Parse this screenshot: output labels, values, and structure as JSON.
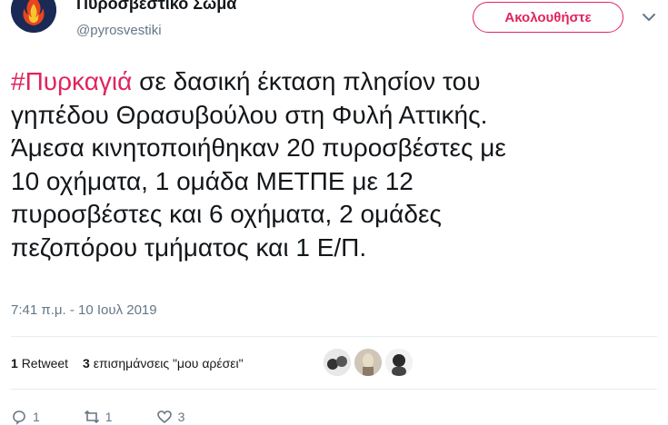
{
  "author": {
    "name": "Πυροσβεστικό Σώμα",
    "handle": "@pyrosvestiki"
  },
  "follow_label": "Ακολουθήστε",
  "tweet": {
    "hashtag": "#Πυρκαγιά",
    "line1_rest": " σε δασική έκταση πλησίον του",
    "lines": [
      "γηπέδου Θρασυβούλου στη Φυλή Αττικής.",
      "Άμεσα κινητοποιήθηκαν 20 πυροσβέστες με",
      "10 οχήματα, 1 ομάδα ΜΕΤΠΕ με 12",
      "πυροσβέστες και 6 οχήματα, 2 ομάδες",
      "πεζοπόρου τμήματος και 1 Ε/Π."
    ],
    "timestamp": "7:41 π.μ. - 10 Ιουλ 2019"
  },
  "stats": {
    "retweets_count": "1",
    "retweets_label": "Retweet",
    "likes_count": "3",
    "likes_label": "επισημάνσεις \"μου αρέσει\""
  },
  "actions": {
    "reply_count": "1",
    "retweet_count": "1",
    "like_count": "3"
  },
  "colors": {
    "accent": "#e0245e",
    "secondary_text": "#657786",
    "divider": "#e6ecf0"
  }
}
